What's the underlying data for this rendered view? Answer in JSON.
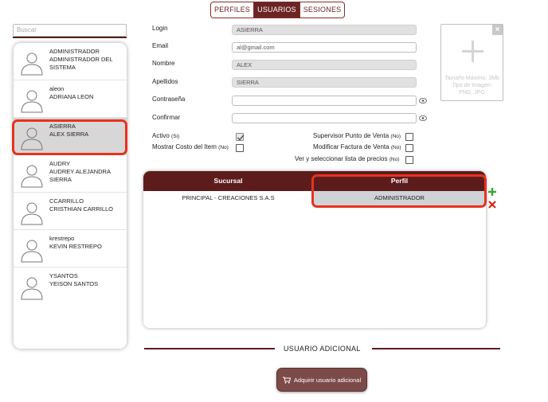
{
  "tabs": [
    {
      "label": "PERFILES",
      "active": false
    },
    {
      "label": "USUARIOS",
      "active": true
    },
    {
      "label": "SESIONES",
      "active": false
    }
  ],
  "search": {
    "placeholder": "Buscar"
  },
  "users": [
    {
      "login": "ADMINISTRADOR",
      "name": "ADMINISTRADOR DEL SISTEMA",
      "selected": false
    },
    {
      "login": "aleon",
      "name": "ADRIANA LEON",
      "selected": false
    },
    {
      "login": "ASIERRA",
      "name": "ALEX SIERRA",
      "selected": true
    },
    {
      "login": "AUDRY",
      "name": "AUDREY ALEJANDRA SIERRA",
      "selected": false
    },
    {
      "login": "CCARRILLO",
      "name": "CRISTHIAN CARRILLO",
      "selected": false
    },
    {
      "login": "krestrepo",
      "name": "KEVIN RESTREPO",
      "selected": false
    },
    {
      "login": "YSANTOS",
      "name": "YEISON SANTOS",
      "selected": false
    }
  ],
  "form": {
    "login": {
      "label": "Login",
      "value": "ASIERRA"
    },
    "email": {
      "label": "Email",
      "value": "al@gmail.com"
    },
    "nombre": {
      "label": "Nombre",
      "value": "ALEX"
    },
    "apellidos": {
      "label": "Apellidos",
      "value": "SIERRA"
    },
    "contrasena": {
      "label": "Contraseña",
      "value": ""
    },
    "confirmar": {
      "label": "Confirmar",
      "value": ""
    }
  },
  "flags": {
    "activo": {
      "label": "Activo",
      "hint": "(Si)",
      "checked": true
    },
    "mostrar_costo": {
      "label": "Mostrar Costo del Item",
      "hint": "(No)",
      "checked": false
    },
    "supervisor": {
      "label": "Supervisor Punto de Venta",
      "hint": "(No)",
      "checked": false
    },
    "modificar_factura": {
      "label": "Modificar Factura de Venta",
      "hint": "(No)",
      "checked": false
    },
    "ver_lista": {
      "label": "Ver y seleccionar lista de precios",
      "hint": "(No)",
      "checked": false
    }
  },
  "upload": {
    "close": "×",
    "hint_line1": "Tamaño Máximo: 3Mb",
    "hint_line2": "Tipo de Imagen:",
    "hint_line3": "PNG, JPG"
  },
  "table": {
    "headers": {
      "sucursal": "Sucursal",
      "perfil": "Perfil"
    },
    "rows": [
      {
        "sucursal": "PRINCIPAL - CREACIONES S.A.S",
        "perfil": "ADMINISTRADOR"
      }
    ]
  },
  "additional": {
    "title": "USUARIO ADICIONAL",
    "button": "Adquirir usuario adicional"
  },
  "colors": {
    "brand": "#6b2424",
    "highlight": "#e63320",
    "add": "#3aa335",
    "remove": "#d8261c"
  }
}
